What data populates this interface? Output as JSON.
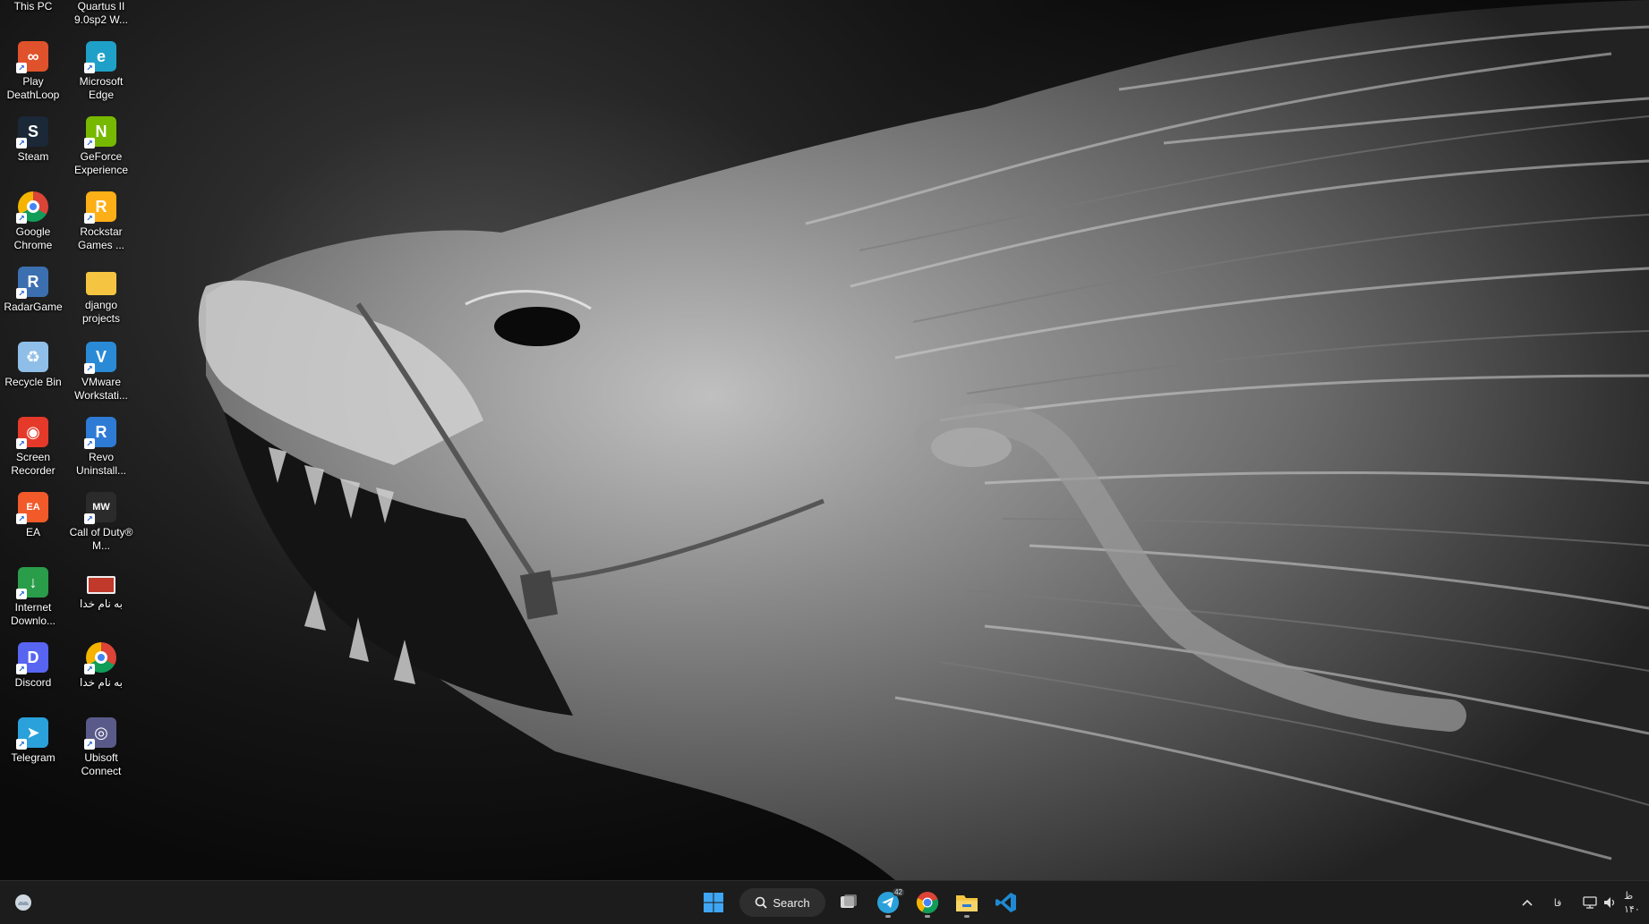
{
  "desktop": {
    "icons": [
      {
        "id": "this-pc",
        "label": "This PC",
        "icon": "computer-icon",
        "color": "#3a8ee6"
      },
      {
        "id": "quartus",
        "label": "Quartus II 9.0sp2 W...",
        "icon": "quartus-icon",
        "color": "#2b6cb0"
      },
      {
        "id": "deathloop",
        "label": "Play DeathLoop",
        "icon": "deathloop-icon",
        "color": "#e0522b"
      },
      {
        "id": "edge",
        "label": "Microsoft Edge",
        "icon": "edge-icon",
        "color": "#1fa0c9"
      },
      {
        "id": "steam",
        "label": "Steam",
        "icon": "steam-icon",
        "color": "#1b2838"
      },
      {
        "id": "geforce",
        "label": "GeForce Experience",
        "icon": "nvidia-icon",
        "color": "#76b900"
      },
      {
        "id": "chrome",
        "label": "Google Chrome",
        "icon": "chrome-icon",
        "color": "#4285f4"
      },
      {
        "id": "rockstar",
        "label": "Rockstar Games ...",
        "icon": "rockstar-icon",
        "color": "#fcaf17"
      },
      {
        "id": "radargame",
        "label": "RadarGame",
        "icon": "radargame-icon",
        "color": "#3c6fb0"
      },
      {
        "id": "django",
        "label": "django projects",
        "icon": "folder-icon",
        "color": "#f5c542"
      },
      {
        "id": "recycle",
        "label": "Recycle Bin",
        "icon": "recycle-bin-icon",
        "color": "#8fbfe8"
      },
      {
        "id": "vmware",
        "label": "VMware Workstati...",
        "icon": "vmware-icon",
        "color": "#2a8ad6"
      },
      {
        "id": "screenrec",
        "label": "Screen Recorder",
        "icon": "screen-recorder-icon",
        "color": "#e53a2a"
      },
      {
        "id": "revo",
        "label": "Revo Uninstall...",
        "icon": "revo-icon",
        "color": "#2e7bd6"
      },
      {
        "id": "ea",
        "label": "EA",
        "icon": "ea-icon",
        "color": "#f25a2a"
      },
      {
        "id": "cod",
        "label": "Call of Duty® M...",
        "icon": "cod-icon",
        "color": "#2b2b2b"
      },
      {
        "id": "idm",
        "label": "Internet Downlo...",
        "icon": "idm-icon",
        "color": "#2a9d4a"
      },
      {
        "id": "farsi1",
        "label": "به نام خدا",
        "icon": "document-icon",
        "color": "#c0392b"
      },
      {
        "id": "discord",
        "label": "Discord",
        "icon": "discord-icon",
        "color": "#5865f2"
      },
      {
        "id": "farsi2",
        "label": "به نام خدا",
        "icon": "chrome-icon",
        "color": "#4285f4"
      },
      {
        "id": "telegram",
        "label": "Telegram",
        "icon": "telegram-icon",
        "color": "#2aa1da"
      },
      {
        "id": "ubisoft",
        "label": "Ubisoft Connect",
        "icon": "ubisoft-icon",
        "color": "#5a5a8a"
      }
    ]
  },
  "taskbar": {
    "weather_icon": "weather-icon",
    "start_icon": "windows-start-icon",
    "search_label": "Search",
    "apps": [
      {
        "name": "task-view",
        "icon": "task-view-icon",
        "running": false
      },
      {
        "name": "telegram",
        "icon": "telegram-icon",
        "running": true,
        "badge": "42"
      },
      {
        "name": "chrome",
        "icon": "chrome-icon",
        "running": true
      },
      {
        "name": "file-explorer",
        "icon": "folder-icon",
        "running": true
      },
      {
        "name": "vscode",
        "icon": "vscode-icon",
        "running": false
      }
    ],
    "tray": {
      "chevron_icon": "chevron-up-icon",
      "language": "فا",
      "network_icon": "network-icon",
      "volume_icon": "volume-icon",
      "clock_line1": "ظ",
      "clock_line2": "۱۴۰"
    }
  }
}
